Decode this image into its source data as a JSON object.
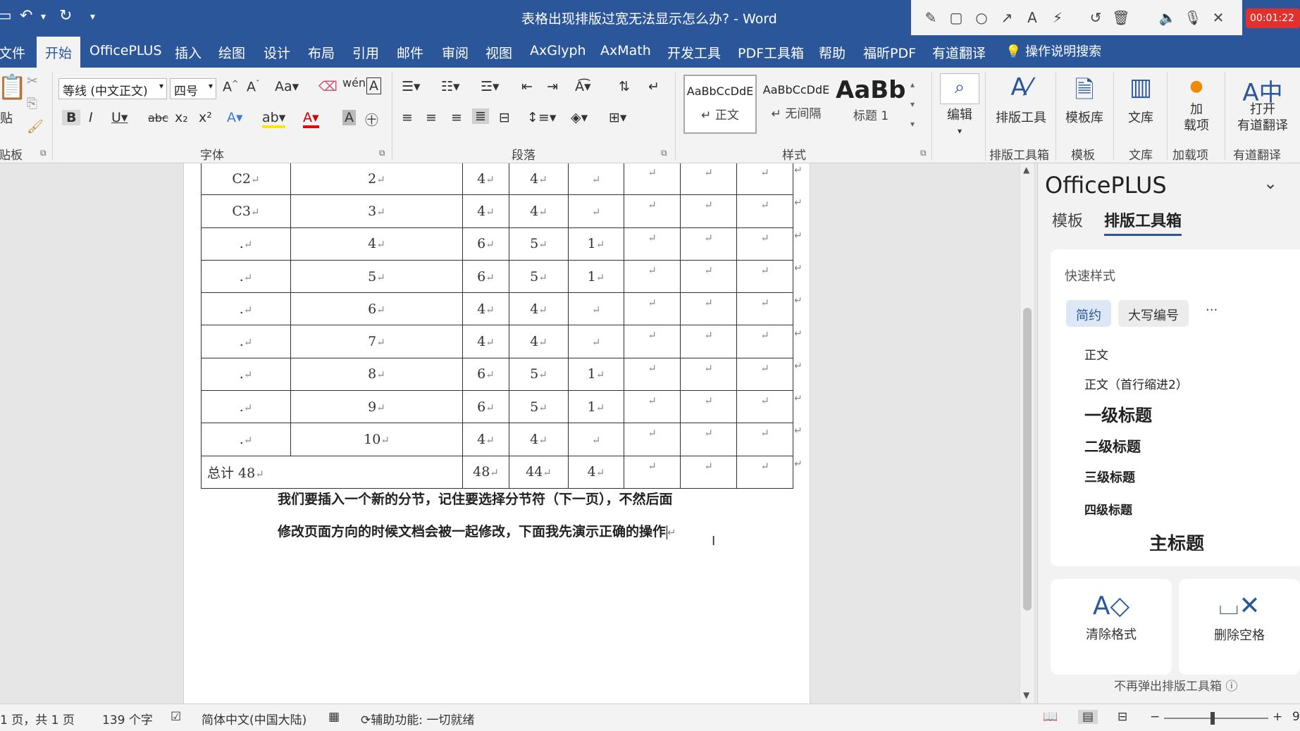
{
  "window": {
    "title": "表格出现排版过宽无法显示怎么办?  -  Word",
    "timer": "00:01:22"
  },
  "quick_access": {
    "save_icon": "save-icon",
    "undo_icon": "undo-icon",
    "redo_icon": "redo-icon",
    "customize_icon": "customize-icon"
  },
  "draw_toolbar": [
    "pen-icon",
    "rectangle-icon",
    "circle-icon",
    "arrow-icon",
    "text-icon",
    "magic-wand-icon",
    "rotate-icon",
    "trash-icon",
    "volume-icon",
    "microphone-icon",
    "close-icon"
  ],
  "ribbon_tabs": [
    "文件",
    "开始",
    "OfficePLUS",
    "插入",
    "绘图",
    "设计",
    "布局",
    "引用",
    "邮件",
    "审阅",
    "视图",
    "AxGlyph",
    "AxMath",
    "开发工具",
    "PDF工具箱",
    "帮助",
    "福昕PDF",
    "有道翻译"
  ],
  "active_tab": "开始",
  "tell_me": "操作说明搜索",
  "ribbon": {
    "clipboard": {
      "paste": "贴",
      "label": "贴板"
    },
    "font": {
      "name": "等线 (中文正文)",
      "size": "四号",
      "label": "字体"
    },
    "paragraph": {
      "label": "段落"
    },
    "styles": {
      "label": "样式",
      "items": [
        {
          "sample": "AaBbCcDdE",
          "name": "正文"
        },
        {
          "sample": "AaBbCcDdE",
          "name": "无间隔"
        },
        {
          "sample": "AaBb(",
          "name": "标题 1"
        }
      ]
    },
    "edit": {
      "label": "编辑"
    },
    "buttons": [
      {
        "name": "排版工具",
        "group": "排版工具箱"
      },
      {
        "name": "模板库",
        "group": "模板"
      },
      {
        "name": "文库",
        "group": "文库"
      },
      {
        "name": "加\n载项",
        "group": "加载项"
      },
      {
        "name": "打开\n有道翻译",
        "group": "有道翻译"
      }
    ]
  },
  "document": {
    "rows": [
      {
        "c1": "C2",
        "c2": "2",
        "c3": "4",
        "c4": "4",
        "c5": ""
      },
      {
        "c1": "C3",
        "c2": "3",
        "c3": "4",
        "c4": "4",
        "c5": ""
      },
      {
        "c1": ".",
        "c2": "4",
        "c3": "6",
        "c4": "5",
        "c5": "1"
      },
      {
        "c1": ".",
        "c2": "5",
        "c3": "6",
        "c4": "5",
        "c5": "1"
      },
      {
        "c1": ".",
        "c2": "6",
        "c3": "4",
        "c4": "4",
        "c5": ""
      },
      {
        "c1": ".",
        "c2": "7",
        "c3": "4",
        "c4": "4",
        "c5": ""
      },
      {
        "c1": ".",
        "c2": "8",
        "c3": "6",
        "c4": "5",
        "c5": "1"
      },
      {
        "c1": ".",
        "c2": "9",
        "c3": "6",
        "c4": "5",
        "c5": "1"
      },
      {
        "c1": ".",
        "c2": "10",
        "c3": "4",
        "c4": "4",
        "c5": ""
      }
    ],
    "total": {
      "label": "总计 48",
      "c3": "48",
      "c4": "44",
      "c5": "4"
    },
    "para_mark": "↵",
    "para_line1": "我们要插入一个新的分节，记住要选择分节符（下一页），不然后面",
    "para_line2": "修改页面方向的时候文档会被一起修改，下面我先演示正确的操作"
  },
  "pane": {
    "title": "OfficePLUS",
    "tabs": [
      "模板",
      "排版工具箱"
    ],
    "active_tab": "排版工具箱",
    "quick_styles": {
      "header": "快速样式",
      "chips": [
        "简约",
        "大写编号"
      ],
      "more": "···",
      "items": [
        "正文",
        "正文（首行缩进2）",
        "一级标题",
        "二级标题",
        "三级标题",
        "四级标题",
        "主标题"
      ]
    },
    "actions": [
      "清除格式",
      "删除空格"
    ],
    "footer": "不再弹出排版工具箱 ⓘ"
  },
  "status": {
    "page": "1 页，共 1 页",
    "words": "139 个字",
    "language": "简体中文(中国大陆)",
    "accessibility": "辅助功能: 一切就绪",
    "zoom": "9"
  }
}
